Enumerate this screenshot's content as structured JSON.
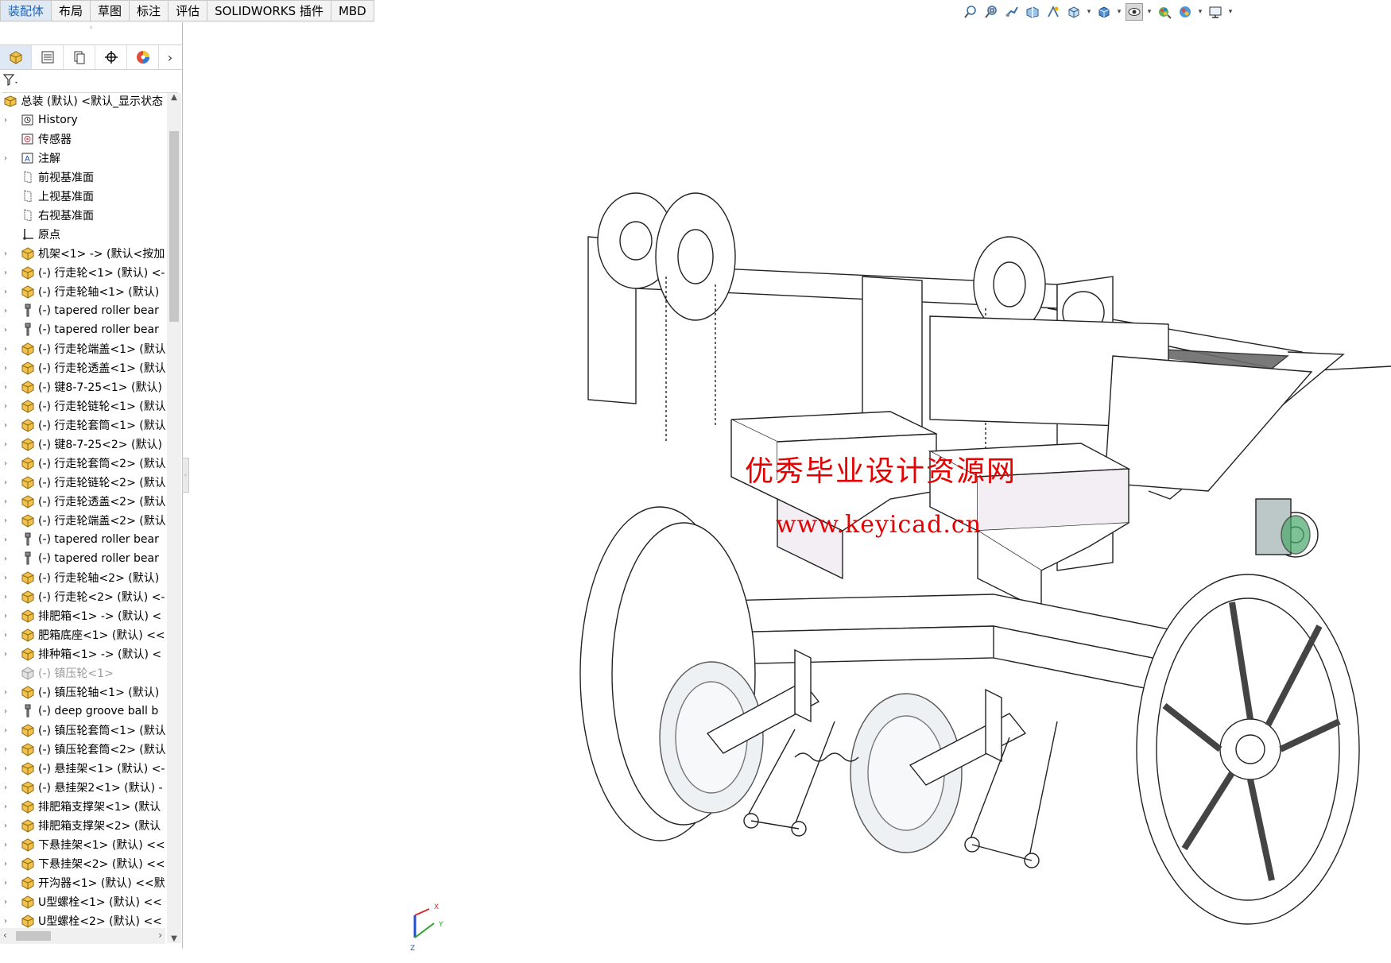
{
  "tabs": [
    "装配体",
    "布局",
    "草图",
    "标注",
    "评估",
    "SOLIDWORKS 插件",
    "MBD"
  ],
  "hud_icons": [
    "zoom-to-fit-icon",
    "zoom-area-icon",
    "previous-view-icon",
    "section-view-icon",
    "dynamic-annotation-icon",
    "view-orientation-icon",
    "display-style-icon",
    "hide-show-icon",
    "edit-appearance-icon",
    "apply-scene-icon",
    "view-settings-icon"
  ],
  "panel": {
    "grip": "◦",
    "tabs": [
      "featuremanager-tab",
      "propertymanager-tab",
      "configurationmanager-tab",
      "dimxpert-tab",
      "displaymanager-tab"
    ],
    "more": "›",
    "filter_icon": "filter-icon",
    "root_label": "总装 (默认) <默认_显示状态",
    "items": [
      {
        "label": "History",
        "icon": "history",
        "expand": true
      },
      {
        "label": "传感器",
        "icon": "sensor",
        "expand": false
      },
      {
        "label": "注解",
        "icon": "annotation",
        "expand": true
      },
      {
        "label": "前视基准面",
        "icon": "plane",
        "expand": false
      },
      {
        "label": "上视基准面",
        "icon": "plane",
        "expand": false
      },
      {
        "label": "右视基准面",
        "icon": "plane",
        "expand": false
      },
      {
        "label": "原点",
        "icon": "origin",
        "expand": false
      },
      {
        "label": "机架<1> -> (默认<按加",
        "icon": "part",
        "expand": true
      },
      {
        "label": "(-) 行走轮<1> (默认) <-",
        "icon": "part",
        "expand": true
      },
      {
        "label": "(-) 行走轮轴<1> (默认)",
        "icon": "part",
        "expand": true
      },
      {
        "label": "(-) tapered roller bear",
        "icon": "toolbox",
        "expand": true
      },
      {
        "label": "(-) tapered roller bear",
        "icon": "toolbox",
        "expand": true
      },
      {
        "label": "(-) 行走轮端盖<1> (默认",
        "icon": "part",
        "expand": true
      },
      {
        "label": "(-) 行走轮透盖<1> (默认",
        "icon": "part",
        "expand": true
      },
      {
        "label": "(-) 键8-7-25<1> (默认)",
        "icon": "part",
        "expand": true
      },
      {
        "label": "(-) 行走轮链轮<1> (默认",
        "icon": "part",
        "expand": true
      },
      {
        "label": "(-) 行走轮套筒<1> (默认",
        "icon": "part",
        "expand": true
      },
      {
        "label": "(-) 键8-7-25<2> (默认)",
        "icon": "part",
        "expand": true
      },
      {
        "label": "(-) 行走轮套筒<2> (默认",
        "icon": "part",
        "expand": true
      },
      {
        "label": "(-) 行走轮链轮<2> (默认",
        "icon": "part",
        "expand": true
      },
      {
        "label": "(-) 行走轮透盖<2> (默认",
        "icon": "part",
        "expand": true
      },
      {
        "label": "(-) 行走轮端盖<2> (默认",
        "icon": "part",
        "expand": true
      },
      {
        "label": "(-) tapered roller bear",
        "icon": "toolbox",
        "expand": true
      },
      {
        "label": "(-) tapered roller bear",
        "icon": "toolbox",
        "expand": true
      },
      {
        "label": "(-) 行走轮轴<2> (默认)",
        "icon": "part",
        "expand": true
      },
      {
        "label": "(-) 行走轮<2> (默认) <-",
        "icon": "part",
        "expand": true
      },
      {
        "label": "排肥箱<1> -> (默认) <",
        "icon": "part",
        "expand": true
      },
      {
        "label": "肥箱底座<1> (默认) <<",
        "icon": "part",
        "expand": true
      },
      {
        "label": "排种箱<1> -> (默认) <",
        "icon": "part",
        "expand": true
      },
      {
        "label": "(-) 镇压轮<1>",
        "icon": "part-suppressed",
        "expand": false,
        "dim": true
      },
      {
        "label": "(-) 镇压轮轴<1> (默认)",
        "icon": "part",
        "expand": true
      },
      {
        "label": "(-) deep groove ball b",
        "icon": "toolbox",
        "expand": true
      },
      {
        "label": "(-) 镇压轮套筒<1> (默认",
        "icon": "part",
        "expand": true
      },
      {
        "label": "(-) 镇压轮套筒<2> (默认",
        "icon": "part",
        "expand": true
      },
      {
        "label": "(-) 悬挂架<1> (默认) <-",
        "icon": "part",
        "expand": true
      },
      {
        "label": "(-) 悬挂架2<1> (默认) -",
        "icon": "part",
        "expand": true
      },
      {
        "label": "排肥箱支撑架<1> (默认",
        "icon": "part",
        "expand": true
      },
      {
        "label": "排肥箱支撑架<2> (默认",
        "icon": "part",
        "expand": true
      },
      {
        "label": "下悬挂架<1> (默认) <<",
        "icon": "part",
        "expand": true
      },
      {
        "label": "下悬挂架<2> (默认) <<",
        "icon": "part",
        "expand": true
      },
      {
        "label": "开沟器<1> (默认) <<默",
        "icon": "part",
        "expand": true
      },
      {
        "label": "U型螺栓<1> (默认) <<",
        "icon": "part",
        "expand": true
      },
      {
        "label": "U型螺栓<2> (默认) <<",
        "icon": "part",
        "expand": true
      }
    ]
  },
  "watermark": {
    "line1": "优秀毕业设计资源网",
    "line2": "www.keyicad.cn"
  },
  "triad": {
    "x": "X",
    "y": "Y",
    "z": "Z"
  }
}
